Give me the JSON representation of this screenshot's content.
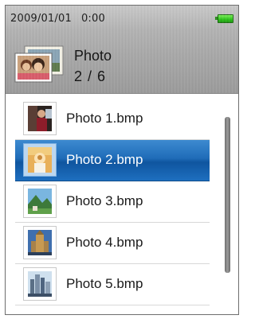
{
  "status": {
    "date": "2009/01/01",
    "time": "0:00",
    "battery_icon": "battery-full-icon",
    "battery_color": "#2cc21b"
  },
  "header": {
    "icon": "photo-album-icon",
    "title": "Photo",
    "count": "2 / 6"
  },
  "list": {
    "selected_index": 1,
    "selected_color": "#1f6cb8",
    "items": [
      {
        "label": "Photo 1.bmp",
        "thumb_icon": "photo-thumbnail-icon"
      },
      {
        "label": "Photo 2.bmp",
        "thumb_icon": "photo-thumbnail-icon"
      },
      {
        "label": "Photo 3.bmp",
        "thumb_icon": "photo-thumbnail-icon"
      },
      {
        "label": "Photo 4.bmp",
        "thumb_icon": "photo-thumbnail-icon"
      },
      {
        "label": "Photo 5.bmp",
        "thumb_icon": "photo-thumbnail-icon"
      }
    ]
  }
}
